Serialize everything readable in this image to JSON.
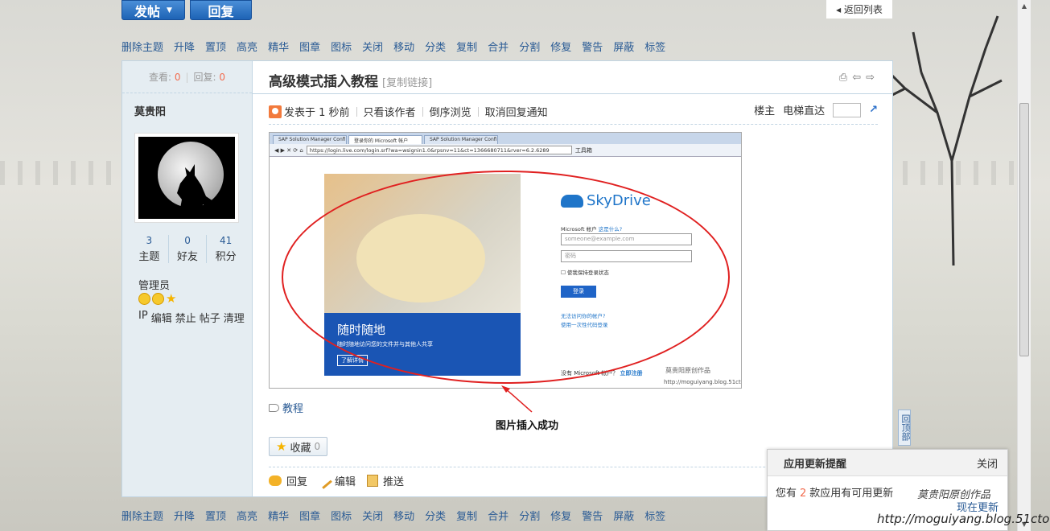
{
  "top_buttons": {
    "post": "发帖",
    "reply": "回复",
    "back": "返回列表"
  },
  "mod_actions": [
    "删除主题",
    "升降",
    "置顶",
    "高亮",
    "精华",
    "图章",
    "图标",
    "关闭",
    "移动",
    "分类",
    "复制",
    "合并",
    "分割",
    "修复",
    "警告",
    "屏蔽",
    "标签"
  ],
  "side": {
    "views_label": "查看:",
    "views": "0",
    "replies_label": "回复:",
    "replies": "0",
    "author": "莫贵阳",
    "stats": [
      {
        "n": "3",
        "l": "主题"
      },
      {
        "n": "0",
        "l": "好友"
      },
      {
        "n": "41",
        "l": "积分"
      }
    ],
    "group": "管理员",
    "tools": [
      "IP",
      "编辑",
      "禁止",
      "帖子",
      "清理"
    ]
  },
  "thread": {
    "title": "高级模式插入教程",
    "copy_link": "[复制链接]",
    "posted": "发表于 1 秒前",
    "only_author": "只看该作者",
    "reverse": "倒序浏览",
    "cancel_notify": "取消回复通知",
    "floor": "楼主",
    "elevator": "电梯直达"
  },
  "screenshot": {
    "tabs": [
      "SAP Solution Manager Confi...",
      "登录你的 Microsoft 帐户",
      "SAP Solution Manager Confi..."
    ],
    "url": "https://login.live.com/login.srf?wa=wsignin1.0&rpsnv=11&ct=1366680711&rver=6.2.6289",
    "toolbar_label": "工具箱",
    "promo_title": "随时随地",
    "promo_sub": "随时随地访问您的文件并与其他人共享",
    "promo_btn": "了解详情",
    "brand": "SkyDrive",
    "account_label": "Microsoft 帐户",
    "what_is": "这是什么?",
    "email_placeholder": "someone@example.com",
    "password_placeholder": "密码",
    "keep_signed": "使我保持登录状态",
    "signin": "登录",
    "cant_access": "无法访问你的帐户?",
    "one_time": "使用一次性代码登录",
    "no_account": "没有 Microsoft 帐户？",
    "signup": "立即注册",
    "watermark_cn": "莫贵阳原创作品",
    "watermark_url": "http://moguiyang.blog.51cto.com"
  },
  "caption": "图片插入成功",
  "tag": "教程",
  "favorite": {
    "label": "收藏",
    "count": "0"
  },
  "actions": {
    "reply": "回复",
    "edit": "编辑",
    "push": "推送"
  },
  "back_to_top": "回顶部",
  "notify": {
    "title": "应用更新提醒",
    "close": "关闭",
    "body_prefix": "您有",
    "count": "2",
    "body_suffix": "款应用有可用更新",
    "link": "现在更新"
  },
  "footer_watermark": {
    "cn": "莫贵阳原创作品",
    "url": "http://moguiyang.blog.51cto.com"
  },
  "colors": {
    "link": "#2a5b95",
    "accent": "#f26c4f",
    "button": "#1e63b5",
    "annotation": "#e02020"
  }
}
